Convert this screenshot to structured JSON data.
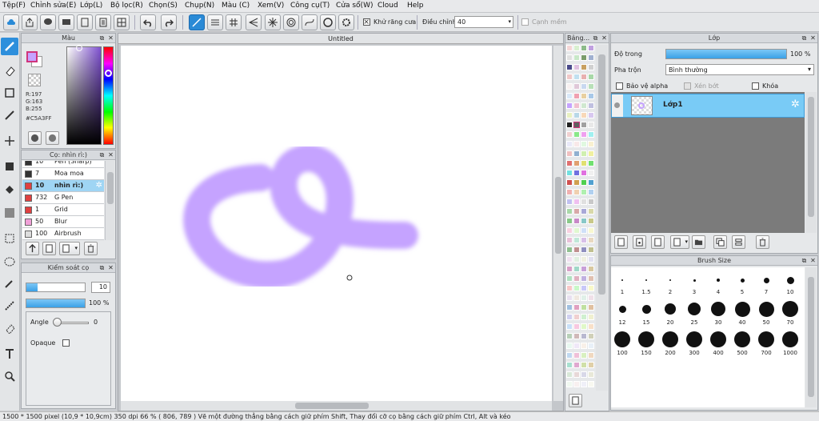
{
  "menu": {
    "file": "Tệp(F)",
    "edit": "Chỉnh sửa(E)",
    "layer": "Lớp(L)",
    "filter": "Bộ lọc(R)",
    "select": "Chọn(S)",
    "capture": "Chụp(N)",
    "color": "Màu (C)",
    "view": "Xem(V)",
    "tools": "Công cụ(T)",
    "window": "Cửa sổ(W)",
    "cloud": "Cloud",
    "help": "Help"
  },
  "toolbar": {
    "antialias_label": "Khử răng cưa",
    "correction_label": "Điều chỉnh",
    "correction_value": "40",
    "smooth_label": "Cạnh mềm"
  },
  "color_panel": {
    "title": "Màu",
    "r": "R:197",
    "g": "G:163",
    "b": "B:255",
    "hex": "#C5A3FF",
    "fg_color": "#c5a3ff"
  },
  "brush_panel": {
    "title": "Cọ: nhìn rì:)",
    "items": [
      {
        "size": "10",
        "name": "Pen (Sharp)",
        "color": "#333333"
      },
      {
        "size": "7",
        "name": "Moa moa",
        "color": "#333333"
      },
      {
        "size": "10",
        "name": "nhìn rì:)",
        "color": "#e04040"
      },
      {
        "size": "732",
        "name": "G Pen",
        "color": "#e04040"
      },
      {
        "size": "1",
        "name": "Grid",
        "color": "#e04040"
      },
      {
        "size": "50",
        "name": "Blur",
        "color": "#f0a0d8"
      },
      {
        "size": "100",
        "name": "Airbrush",
        "color": "#dddddd"
      }
    ]
  },
  "control_panel": {
    "title": "Kiểm soát cọ",
    "size_value": "10",
    "opacity_value": "100 %",
    "angle_label": "Angle",
    "angle_value": "0",
    "opaque_label": "Opaque"
  },
  "canvas": {
    "tab_title": "Untitled"
  },
  "palette_panel": {
    "title": "Bảng..."
  },
  "layer_panel": {
    "title": "Lớp",
    "opacity_label": "Độ trong",
    "opacity_value": "100 %",
    "blend_label": "Pha trộn",
    "blend_value": "Bình thường",
    "protect_alpha": "Bảo vệ alpha",
    "clip": "Xén bớt",
    "lock": "Khóa",
    "layer_name": "Lớp1"
  },
  "size_panel": {
    "title": "Brush Size",
    "sizes": [
      "1",
      "1.5",
      "2",
      "3",
      "4",
      "5",
      "7",
      "10",
      "12",
      "15",
      "20",
      "25",
      "30",
      "40",
      "50",
      "70",
      "100",
      "150",
      "200",
      "300",
      "400",
      "500",
      "700",
      "1000"
    ]
  },
  "status": {
    "text": "1500 * 1500 pixel  (10,9 * 10,9cm)  350 dpi  66 %  ( 806, 789 )  Vẽ một đường thẳng bằng cách giữ phím Shift, Thay đổi cỡ cọ bằng cách giữ phím Ctrl, Alt và kéo"
  }
}
